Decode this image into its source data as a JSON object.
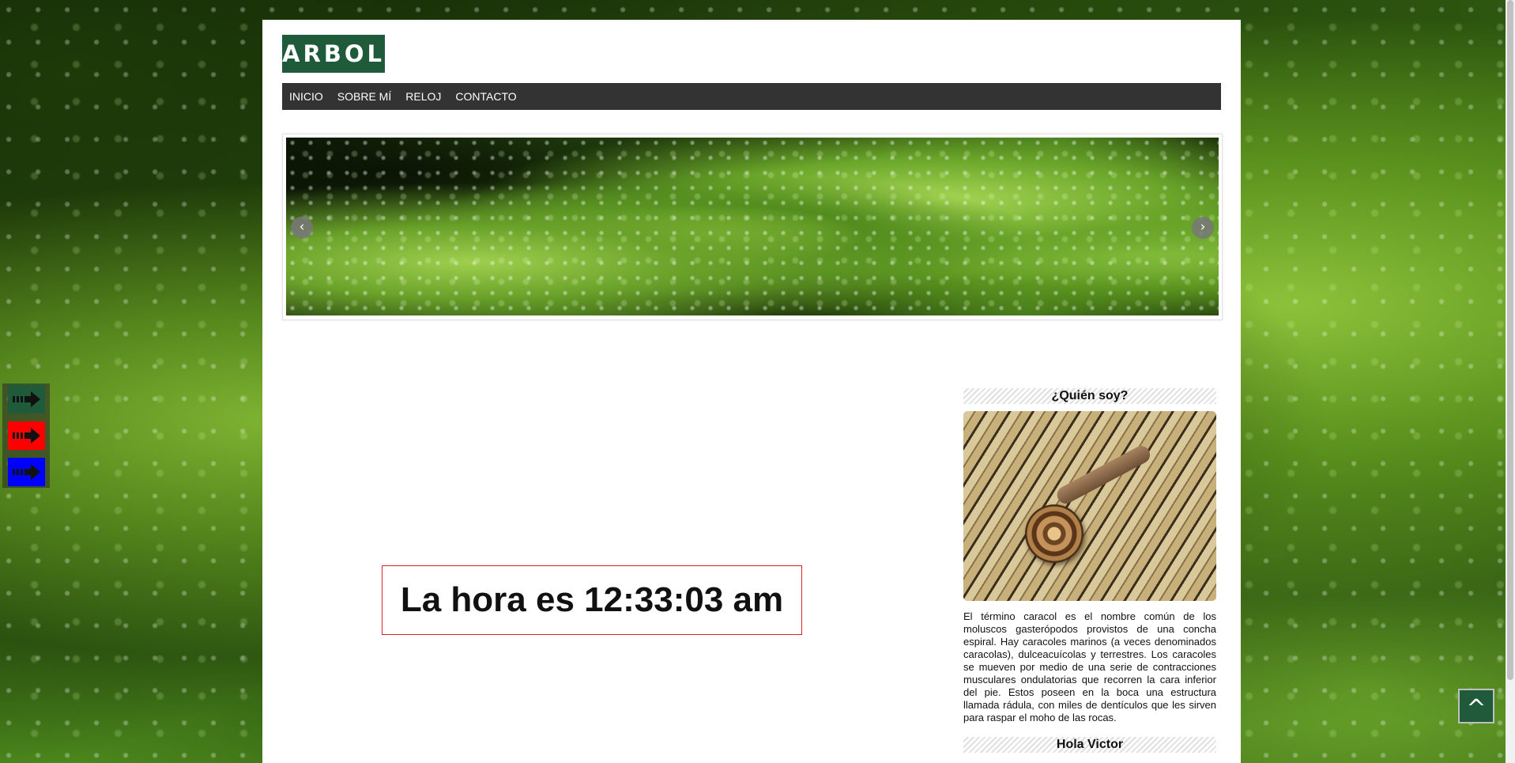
{
  "site": {
    "logo": "ARBOL"
  },
  "nav": {
    "items": [
      "INICIO",
      "SOBRE MÍ",
      "RELOJ",
      "CONTACTO"
    ]
  },
  "slider": {
    "prev_icon": "chevron-left-icon",
    "next_icon": "chevron-right-icon",
    "prev_symbol": "‹",
    "next_symbol": "›"
  },
  "clock": {
    "text": "La hora es 12:33:03 am"
  },
  "sidebar": {
    "widget1_title": "¿Quién soy?",
    "image_alt": "Caracol sobre cañas de bambú",
    "description": "El término caracol es el nombre común de los moluscos gasterópodos provistos de una concha espiral. Hay caracoles marinos (a veces denominados caracolas), dulceacuícolas y terrestres. Los caracoles se mueven por medio de una serie de contracciones musculares ondulatorias que recorren la cara inferior del pie. Estos poseen en la boca una estructura llamada rádula, con miles de dentículos que les sirven para raspar el moho de las rocas.",
    "widget2_title": "Hola Victor"
  },
  "side_tools": {
    "colors": [
      "#1f5a3b",
      "#ff0000",
      "#0000ff"
    ],
    "icon": "arrow-right-icon"
  },
  "back_to_top": {
    "label": "^"
  },
  "colors": {
    "brand_green": "#1f5a3b",
    "nav_bg": "#333333",
    "clock_border": "#d9242b"
  }
}
